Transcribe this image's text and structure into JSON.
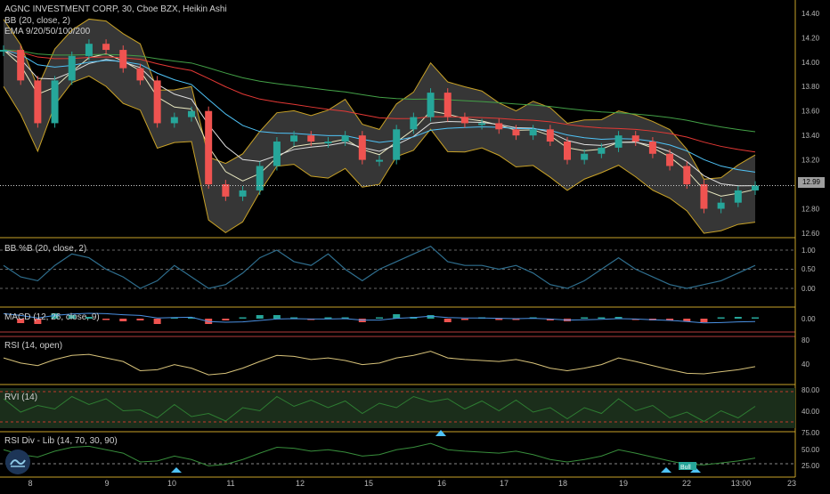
{
  "header": {
    "title": "AGNC INVESTMENT CORP, 30, Cboe BZX, Heikin Ashi",
    "bb": "BB (20, close, 2)",
    "ema": "EMA 9/20/50/100/200"
  },
  "price_tag": "12.99",
  "panes": [
    {
      "title": "BB %B (20, close, 2)",
      "ticks": [
        "1.00",
        "0.50",
        "0.00"
      ]
    },
    {
      "title": "MACD (12, 26, close, 9)",
      "ticks": [
        "0.00"
      ]
    },
    {
      "title": "RSI (14, open)",
      "ticks": [
        "80",
        "40"
      ]
    },
    {
      "title": "RVI (14)",
      "ticks": [
        "80.00",
        "40.00"
      ]
    },
    {
      "title": "RSI Div - Lib (14, 70, 30, 90)",
      "ticks": [
        "75.00",
        "50.00",
        "25.00"
      ]
    }
  ],
  "bull_label": "Bull",
  "colors": {
    "up": "#26a69a",
    "down": "#ef5350",
    "band": "#c9a227",
    "bg": "#000000",
    "line": "#d8c37a"
  },
  "chart_data": {
    "type": "line",
    "series_type": "heikin-ashi",
    "x": [
      "8",
      "9",
      "10",
      "11",
      "12",
      "15",
      "16",
      "17",
      "18",
      "19",
      "22",
      "13:00",
      "23"
    ],
    "y_ticks": [
      "14.40",
      "14.20",
      "14.00",
      "13.80",
      "13.60",
      "13.40",
      "13.20",
      "13.00",
      "12.80",
      "12.60"
    ],
    "ylim": [
      12.6,
      14.45
    ],
    "price": [
      14.1,
      13.85,
      13.5,
      13.85,
      14.05,
      14.15,
      14.1,
      13.95,
      13.85,
      13.5,
      13.55,
      13.6,
      13.0,
      12.9,
      12.95,
      13.15,
      13.35,
      13.4,
      13.35,
      13.35,
      13.4,
      13.2,
      13.2,
      13.45,
      13.55,
      13.75,
      13.55,
      13.5,
      13.5,
      13.45,
      13.4,
      13.45,
      13.35,
      13.2,
      13.25,
      13.3,
      13.4,
      13.35,
      13.25,
      13.15,
      13.0,
      12.8,
      12.85,
      12.95,
      12.99
    ],
    "last": 12.99,
    "bb_pct_b": [
      0.6,
      0.3,
      0.2,
      0.6,
      0.9,
      0.8,
      0.5,
      0.3,
      0.0,
      0.2,
      0.6,
      0.3,
      0.0,
      0.1,
      0.4,
      0.8,
      1.0,
      0.7,
      0.6,
      0.9,
      0.5,
      0.2,
      0.5,
      0.7,
      0.9,
      1.1,
      0.7,
      0.6,
      0.6,
      0.5,
      0.6,
      0.4,
      0.1,
      0.0,
      0.2,
      0.5,
      0.8,
      0.5,
      0.3,
      0.1,
      0.0,
      0.1,
      0.2,
      0.4,
      0.6
    ],
    "rsi": [
      55,
      45,
      40,
      52,
      60,
      62,
      55,
      48,
      30,
      32,
      42,
      35,
      22,
      25,
      35,
      48,
      60,
      58,
      52,
      55,
      50,
      42,
      45,
      55,
      60,
      68,
      55,
      52,
      50,
      48,
      52,
      45,
      35,
      30,
      35,
      42,
      55,
      48,
      40,
      32,
      25,
      24,
      28,
      32,
      38
    ]
  }
}
